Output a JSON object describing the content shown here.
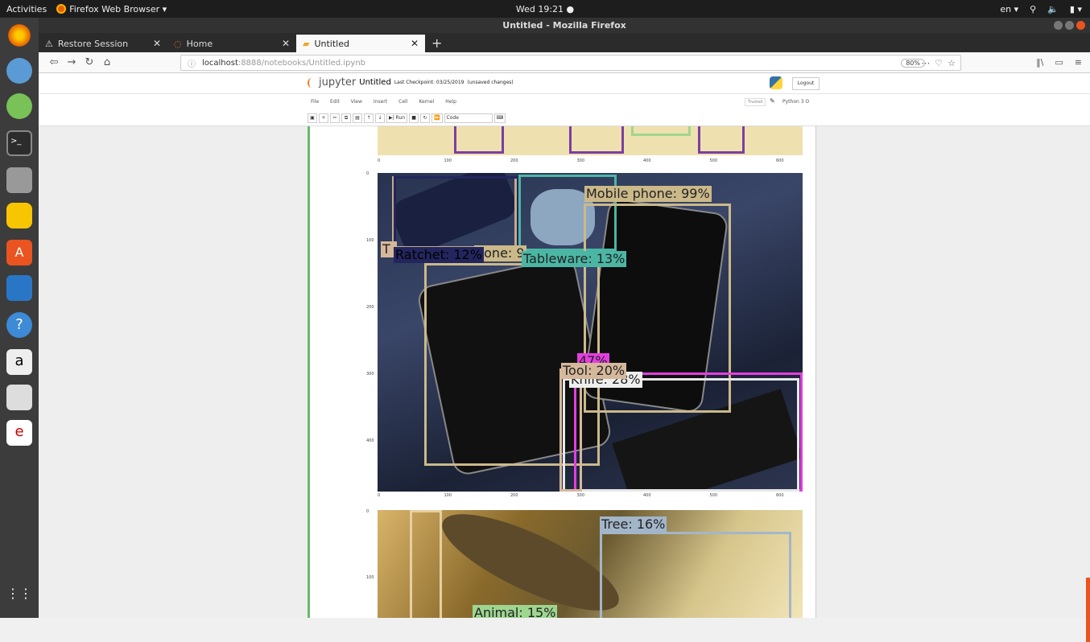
{
  "topbar": {
    "activities": "Activities",
    "app_name": "Firefox Web Browser ▾",
    "clock": "Wed 19:21 ●",
    "lang": "en ▾"
  },
  "window": {
    "title": "Untitled - Mozilla Firefox"
  },
  "tabs": [
    {
      "label": "Restore Session"
    },
    {
      "label": "Home"
    },
    {
      "label": "Untitled"
    }
  ],
  "url": {
    "host": "localhost",
    "rest": ":8888/notebooks/Untitled.ipynb",
    "zoom": "80%"
  },
  "jupyter": {
    "logo_text": "jupyter",
    "notebook_name": "Untitled",
    "checkpoint": "Last Checkpoint: 03/25/2019",
    "unsaved": "(unsaved changes)",
    "logout": "Logout",
    "trusted": "Trusted",
    "kernel": "Python 3 O",
    "menu": [
      "File",
      "Edit",
      "View",
      "Insert",
      "Cell",
      "Kernel",
      "Help"
    ],
    "toolbar": {
      "run": "▶| Run",
      "cell_type": "Code"
    }
  },
  "image1_axis": [
    "0",
    "100",
    "200",
    "300",
    "400",
    "500",
    "600"
  ],
  "image2": {
    "yaxis": [
      "0",
      "100",
      "200",
      "300",
      "400"
    ],
    "xaxis": [
      "0",
      "100",
      "200",
      "300",
      "400",
      "500",
      "600"
    ],
    "labels": {
      "mobile": "Mobile phone: 99%",
      "ratchet": "Ratchet: 12%",
      "phone_partial": "hone: 9",
      "tableware": "Tableware: 13%",
      "tool": "Tool: 20%",
      "knife_pct": "47%",
      "knife_partial": "Knife: 28%",
      "t": "T"
    }
  },
  "image3": {
    "yaxis": [
      "0",
      "100"
    ],
    "labels": {
      "tree": "Tree: 16%",
      "animal": "Animal: 15%"
    }
  },
  "colors": {
    "ubuntu_orange": "#e95420",
    "jupyter_orange": "#f37626",
    "cell_green": "#66bb6a"
  }
}
